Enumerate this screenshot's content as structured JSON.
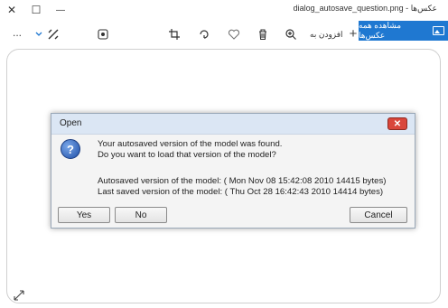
{
  "window": {
    "title": "dialog_autosave_question.png - عکس‌ها",
    "controls": {
      "close": "✕",
      "maximize": "☐",
      "minimize": "—"
    }
  },
  "toolbar": {
    "more_label": "...",
    "add_to_label": "افزودن به",
    "add_plus": "+",
    "see_all_label": "مشاهده همه عکس‌ها"
  },
  "dialog": {
    "title": "Open",
    "close_glyph": "✕",
    "question_glyph": "?",
    "message_line1": "Your autosaved version of the model was found.",
    "message_line2": "Do you want to load that version of the model?",
    "autosaved_info": "Autosaved version of the model: ( Mon Nov 08 15:42:08 2010 14415 bytes)",
    "last_saved_info": "Last saved version of the model: ( Thu Oct 28 16:42:43 2010 14414 bytes)",
    "buttons": {
      "yes": "Yes",
      "no": "No",
      "cancel": "Cancel"
    }
  },
  "colors": {
    "accent": "#1f78d1",
    "dialog_close": "#d9463b",
    "dialog_title": "#dbe6f4"
  },
  "icons": [
    "close-icon",
    "maximize-icon",
    "minimize-icon",
    "more-icon",
    "chevron-down-icon",
    "edit-icon",
    "sun-icon",
    "crop-icon",
    "rotate-icon",
    "heart-icon",
    "delete-icon",
    "zoom-icon",
    "plus-icon",
    "photos-icon",
    "resize-icon",
    "question-icon"
  ]
}
